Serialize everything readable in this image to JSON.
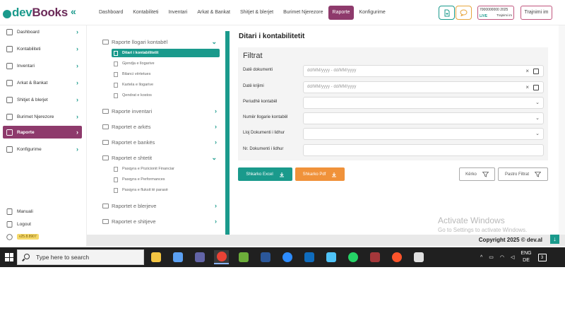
{
  "header": {
    "logo_dev": "dev",
    "logo_books": "Books",
    "collapse_icon": "«",
    "nav": [
      {
        "label": "Dashboard",
        "active": false
      },
      {
        "label": "Kontabiliteti",
        "active": false
      },
      {
        "label": "Inventari",
        "active": false
      },
      {
        "label": "Arkat & Bankat",
        "active": false
      },
      {
        "label": "Shitjet & blerjet",
        "active": false
      },
      {
        "label": "Burimet Njerezore",
        "active": false
      },
      {
        "label": "Raporte",
        "active": true
      },
      {
        "label": "Konfigurime",
        "active": false
      }
    ],
    "license_id": "7000000000 2025",
    "license_status": "LIVE",
    "license_plan": "Trajnimi im",
    "logout_label": "Trajnimi im"
  },
  "sidebar": {
    "items": [
      {
        "label": "Dashboard",
        "icon": "grid-icon"
      },
      {
        "label": "Kontabiliteti",
        "icon": "folder-icon"
      },
      {
        "label": "Inventari",
        "icon": "box-icon"
      },
      {
        "label": "Arkat & Bankat",
        "icon": "bank-icon"
      },
      {
        "label": "Shitjet & blerjet",
        "icon": "cart-icon"
      },
      {
        "label": "Burimet Njerezore",
        "icon": "people-icon"
      },
      {
        "label": "Raporte",
        "icon": "chart-icon"
      },
      {
        "label": "Konfigurime",
        "icon": "gear-icon"
      }
    ],
    "bottom": [
      {
        "label": "Manuali",
        "icon": "book-icon"
      },
      {
        "label": "Logout",
        "icon": "logout-icon"
      }
    ],
    "version": "v25.8.8907"
  },
  "tree": {
    "sections": [
      {
        "label": "Raporte llogari kontabël",
        "expanded": true,
        "items": [
          "Ditari i kontabilitetit",
          "Gjendja e llogarive",
          "Bilanci vërtetues",
          "Kartela e llogarive",
          "Qendrat e kostos"
        ]
      },
      {
        "label": "Raporte inventari",
        "expanded": false
      },
      {
        "label": "Raportet e arkës",
        "expanded": false
      },
      {
        "label": "Raportet e bankës",
        "expanded": false
      },
      {
        "label": "Raportet e shtetit",
        "expanded": true,
        "items": [
          "Pasqyra e Pozicionit Financiar",
          "Pasqyra e Performances",
          "Pasqyra e fluksit të parasë"
        ]
      },
      {
        "label": "Raportet e blerjeve",
        "expanded": false
      },
      {
        "label": "Raportet e shitjeve",
        "expanded": false
      }
    ],
    "active_item": "Ditari i kontabilitetit"
  },
  "main": {
    "title": "Ditari i kontabilitetit",
    "filters_title": "Filtrat",
    "fields": [
      {
        "label": "Datë dokumenti",
        "placeholder": "dd/MM/yyyy - dd/MM/yyyy",
        "type": "date"
      },
      {
        "label": "Datë krijimi",
        "placeholder": "dd/MM/yyyy - dd/MM/yyyy",
        "type": "date"
      },
      {
        "label": "Periudhë kontabël",
        "placeholder": "",
        "type": "select"
      },
      {
        "label": "Numër llogarie kontabël",
        "placeholder": "",
        "type": "select"
      },
      {
        "label": "Lloj Dokumenti i lidhur",
        "placeholder": "",
        "type": "select"
      },
      {
        "label": "Nr. Dokumenti i lidhur",
        "placeholder": "",
        "type": "text"
      }
    ],
    "buttons": {
      "excel": "Shkarko Excel",
      "pdf": "Shkarko Pdf",
      "search": "Kërko",
      "clear": "Pastro Filtrat"
    }
  },
  "watermark": {
    "line1": "Activate Windows",
    "line2": "Go to Settings to activate Windows."
  },
  "footer": {
    "copyright": "Copyright 2025 © dev.al"
  },
  "taskbar": {
    "search_placeholder": "Type here to search",
    "apps": [
      {
        "name": "file-explorer-icon",
        "color": "#f4c542"
      },
      {
        "name": "copilot-icon",
        "color": "#5ba0f2"
      },
      {
        "name": "teams-icon",
        "color": "#6264a7"
      },
      {
        "name": "chrome-icon",
        "color": "#e94235"
      },
      {
        "name": "feather-icon",
        "color": "#6cae3a"
      },
      {
        "name": "word-icon",
        "color": "#2b579a"
      },
      {
        "name": "zoom-icon",
        "color": "#2d8cff"
      },
      {
        "name": "outlook-icon",
        "color": "#0f6cbd"
      },
      {
        "name": "calculator-icon",
        "color": "#4fc3f7"
      },
      {
        "name": "whatsapp-icon",
        "color": "#25d366"
      },
      {
        "name": "access-icon",
        "color": "#a4373a"
      },
      {
        "name": "brave-icon",
        "color": "#fb542b"
      },
      {
        "name": "stack-icon",
        "color": "#e0e0e0"
      }
    ],
    "lang_top": "ENG",
    "lang_bottom": "DE",
    "notif_count": "3"
  }
}
